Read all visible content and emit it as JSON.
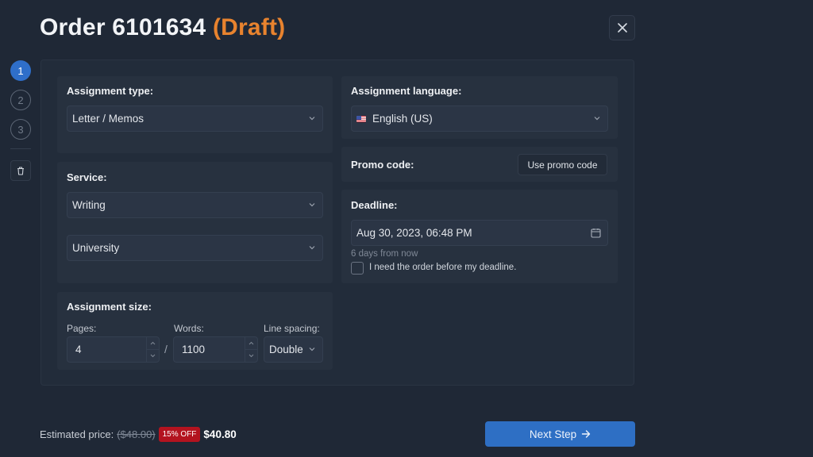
{
  "header": {
    "title_prefix": "Order 6101634",
    "status": "(Draft)",
    "status_color": "#e8832e"
  },
  "close_icon": "close-icon",
  "stepper": {
    "steps": [
      {
        "label": "1",
        "active": true
      },
      {
        "label": "2",
        "active": false
      },
      {
        "label": "3",
        "active": false
      }
    ],
    "delete_icon": "trash-icon"
  },
  "form": {
    "assignment_type": {
      "label": "Assignment type:",
      "value": "Letter / Memos"
    },
    "service": {
      "label": "Service:",
      "value": "Writing",
      "level": "University"
    },
    "assignment_size": {
      "label": "Assignment size:",
      "pages_label": "Pages:",
      "pages": "4",
      "separator": "/",
      "words_label": "Words:",
      "words": "1100",
      "spacing_label": "Line spacing:",
      "spacing": "Double"
    },
    "language": {
      "label": "Assignment language:",
      "value": "English (US)",
      "flag": "us-flag-icon"
    },
    "promo": {
      "label": "Promo code:",
      "button": "Use promo code"
    },
    "deadline": {
      "label": "Deadline:",
      "value": "Aug 30, 2023, 06:48 PM",
      "relative": "6 days from now",
      "checkbox_label": "I need the order before my deadline.",
      "checkbox_checked": false
    }
  },
  "footer": {
    "price_label": "Estimated price:",
    "old_price": "($48.00)",
    "discount_badge": "15% OFF",
    "new_price": "$40.80",
    "badge_color": "#b3131f",
    "next_button": "Next Step",
    "next_button_color": "#2e6fc4"
  }
}
